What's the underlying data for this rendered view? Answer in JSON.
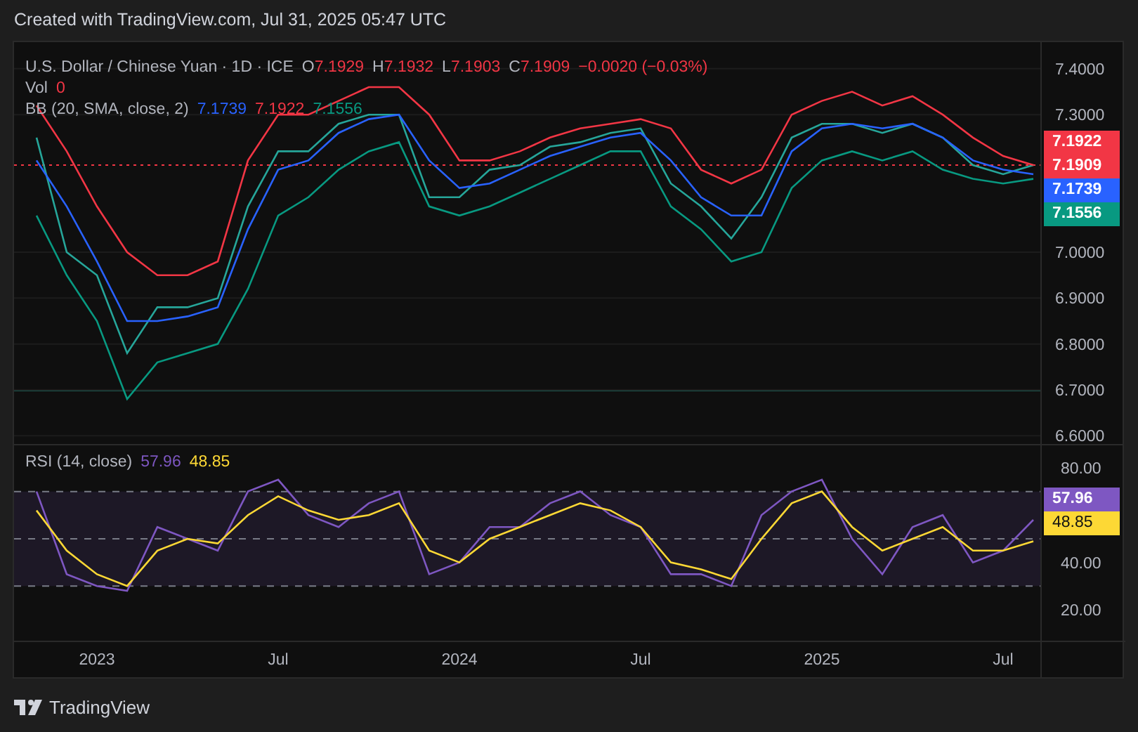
{
  "caption": "Created with TradingView.com, Jul 31, 2025 05:47 UTC",
  "legend": {
    "symbol": "U.S. Dollar / Chinese Yuan · 1D · ICE",
    "ohlc": [
      {
        "key": "O",
        "value": "7.1929"
      },
      {
        "key": "H",
        "value": "7.1932"
      },
      {
        "key": "L",
        "value": "7.1903"
      },
      {
        "key": "C",
        "value": "7.1909"
      }
    ],
    "change": "−0.0020 (−0.03%)",
    "volume": {
      "label": "Vol",
      "value": "0"
    },
    "indicator": {
      "label": "BB (20, SMA, close, 2)",
      "values": [
        {
          "value": "7.1739",
          "color": "#2962ff"
        },
        {
          "value": "7.1922",
          "color": "#f23645"
        },
        {
          "value": "7.1556",
          "color": "#089981"
        }
      ]
    }
  },
  "price_pane": {
    "chart_data": {
      "type": "line",
      "ylim": [
        6.582,
        7.458
      ],
      "yticks": [
        {
          "value": 6.6,
          "label": "6.6000"
        },
        {
          "value": 6.7,
          "label": "6.7000"
        },
        {
          "value": 6.8,
          "label": "6.8000"
        },
        {
          "value": 6.9,
          "label": "6.9000"
        },
        {
          "value": 7.0,
          "label": "7.0000"
        },
        {
          "value": 7.3,
          "label": "7.3000"
        },
        {
          "value": 7.4,
          "label": "7.4000"
        }
      ],
      "series": [
        {
          "color": "#26a69a",
          "values": [
            7.25,
            7.0,
            6.95,
            6.78,
            6.88,
            6.88,
            6.9,
            7.1,
            7.22,
            7.22,
            7.28,
            7.3,
            7.3,
            7.12,
            7.12,
            7.18,
            7.19,
            7.23,
            7.24,
            7.26,
            7.27,
            7.15,
            7.1,
            7.03,
            7.12,
            7.25,
            7.28,
            7.28,
            7.26,
            7.28,
            7.25,
            7.19,
            7.17,
            7.19
          ]
        },
        {
          "color": "#f23645",
          "values": [
            7.32,
            7.22,
            7.1,
            7.0,
            6.95,
            6.95,
            6.98,
            7.2,
            7.3,
            7.3,
            7.33,
            7.36,
            7.36,
            7.3,
            7.2,
            7.2,
            7.22,
            7.25,
            7.27,
            7.28,
            7.29,
            7.27,
            7.18,
            7.15,
            7.18,
            7.3,
            7.33,
            7.35,
            7.32,
            7.34,
            7.3,
            7.25,
            7.21,
            7.19
          ]
        },
        {
          "color": "#2962ff",
          "values": [
            7.2,
            7.1,
            6.98,
            6.85,
            6.85,
            6.86,
            6.88,
            7.05,
            7.18,
            7.2,
            7.26,
            7.29,
            7.3,
            7.2,
            7.14,
            7.15,
            7.18,
            7.21,
            7.23,
            7.25,
            7.26,
            7.2,
            7.12,
            7.08,
            7.08,
            7.22,
            7.27,
            7.28,
            7.27,
            7.28,
            7.25,
            7.2,
            7.18,
            7.17
          ]
        },
        {
          "color": "#089981",
          "values": [
            7.08,
            6.95,
            6.85,
            6.68,
            6.76,
            6.78,
            6.8,
            6.92,
            7.08,
            7.12,
            7.18,
            7.22,
            7.24,
            7.1,
            7.08,
            7.1,
            7.13,
            7.16,
            7.19,
            7.22,
            7.22,
            7.1,
            7.05,
            6.98,
            7.0,
            7.14,
            7.2,
            7.22,
            7.2,
            7.22,
            7.18,
            7.16,
            7.15,
            7.16
          ]
        }
      ],
      "grid": true
    },
    "price_labels": [
      {
        "value": "7.1922",
        "color": "#f23645"
      },
      {
        "value": "7.1909",
        "color": "#f23645"
      },
      {
        "value": "7.1739",
        "color": "#2962ff"
      },
      {
        "value": "7.1556",
        "color": "#089981"
      }
    ]
  },
  "rsi_pane": {
    "legend": {
      "label": "RSI (14, close)",
      "values": [
        {
          "value": "57.96",
          "color": "#7e57c2"
        },
        {
          "value": "48.85",
          "color": "#fdd835"
        }
      ]
    },
    "chart_data": {
      "type": "line",
      "ylim": [
        6.9,
        89.5
      ],
      "categories": [
        null,
        null,
        "2023",
        null,
        null,
        null,
        null,
        null,
        "Jul",
        null,
        null,
        null,
        null,
        null,
        "2024",
        null,
        null,
        null,
        null,
        null,
        "Jul",
        null,
        null,
        null,
        null,
        null,
        "2025",
        null,
        null,
        null,
        null,
        null,
        "Jul",
        null
      ],
      "yticks": [
        {
          "value": 20,
          "label": "20.00"
        },
        {
          "value": 40,
          "label": "40.00"
        },
        {
          "value": 80,
          "label": "80.00"
        }
      ],
      "series": [
        {
          "color": "#7e57c2",
          "values": [
            70,
            35,
            30,
            28,
            55,
            50,
            45,
            70,
            75,
            60,
            55,
            65,
            70,
            35,
            40,
            55,
            55,
            65,
            70,
            60,
            55,
            35,
            35,
            30,
            60,
            70,
            75,
            50,
            35,
            55,
            60,
            40,
            45,
            58
          ]
        },
        {
          "color": "#fdd835",
          "values": [
            62,
            45,
            35,
            30,
            45,
            50,
            48,
            60,
            68,
            62,
            58,
            60,
            65,
            45,
            40,
            50,
            55,
            60,
            65,
            62,
            55,
            40,
            37,
            33,
            50,
            65,
            70,
            55,
            45,
            50,
            55,
            45,
            45,
            49
          ]
        }
      ]
    },
    "labels": [
      {
        "value": "57.96",
        "color": "#7e57c2"
      },
      {
        "value": "48.85",
        "color": "#fdd835"
      }
    ]
  },
  "brand": "TradingView"
}
